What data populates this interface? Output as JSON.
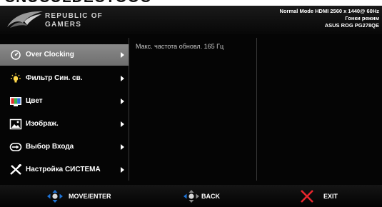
{
  "page_caption": "CNUCULDECTOOC",
  "header": {
    "brand_line1": "REPUBLIC OF",
    "brand_line2": "GAMERS",
    "status_line1": "Normal Mode HDMI 2560 x 1440@ 60Hz",
    "status_line2": "Гонки режим",
    "status_line3": "ASUS ROG PG278QE"
  },
  "menu": {
    "items": [
      {
        "label": "Over Clocking",
        "icon": "speedometer-icon"
      },
      {
        "label": "Фильтр Син. св.",
        "icon": "light-bulb-icon"
      },
      {
        "label": "Цвет",
        "icon": "color-palette-icon"
      },
      {
        "label": "Изображ.",
        "icon": "image-icon"
      },
      {
        "label": "Выбор Входа",
        "icon": "input-source-icon"
      },
      {
        "label": "Настройка СИСТЕМА",
        "icon": "tools-icon"
      }
    ],
    "selected_label": "Over Clocking"
  },
  "submenu": {
    "option": "Макс. частота обновл. 165 Гц"
  },
  "footer": {
    "move_label": "MOVE/ENTER",
    "back_label": "BACK",
    "exit_label": "EXIT"
  },
  "colors": {
    "osd_background": "#050505",
    "selected_item": "#7d7d7d",
    "joystick_blue": "#1e73d6",
    "exit_red": "#e8262d"
  }
}
